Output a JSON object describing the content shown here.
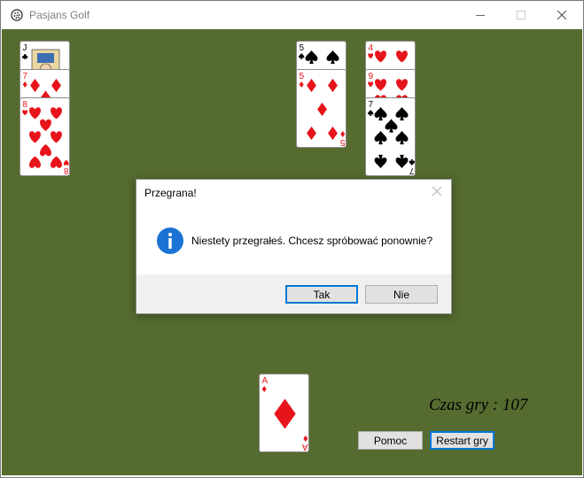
{
  "window": {
    "title": "Pasjans Golf",
    "icon": "golf-ball-icon"
  },
  "board": {
    "felt_color": "#556b2f",
    "columns": [
      {
        "cards": [
          {
            "rank": "J",
            "suit": "clubs"
          },
          {
            "rank": "7",
            "suit": "diamonds"
          },
          {
            "rank": "8",
            "suit": "hearts"
          }
        ]
      },
      {
        "cards": [
          {
            "rank": "5",
            "suit": "spades"
          },
          {
            "rank": "5",
            "suit": "diamonds"
          }
        ]
      },
      {
        "cards": [
          {
            "rank": "4",
            "suit": "hearts"
          },
          {
            "rank": "9",
            "suit": "hearts"
          },
          {
            "rank": "7",
            "suit": "spades"
          }
        ]
      }
    ],
    "waste_card": {
      "rank": "A",
      "suit": "diamonds"
    }
  },
  "timer": {
    "text": "Czas gry : 107"
  },
  "buttons": {
    "help": "Pomoc",
    "restart": "Restart gry"
  },
  "dialog": {
    "title": "Przegrana!",
    "message": "Niestety przegrałeś. Chcesz spróbować ponownie?",
    "icon": "info-icon",
    "yes_label": "Tak",
    "no_label": "Nie"
  },
  "colors": {
    "red_suit": "#e8141b",
    "black_suit": "#000000",
    "accent": "#0078d7"
  }
}
